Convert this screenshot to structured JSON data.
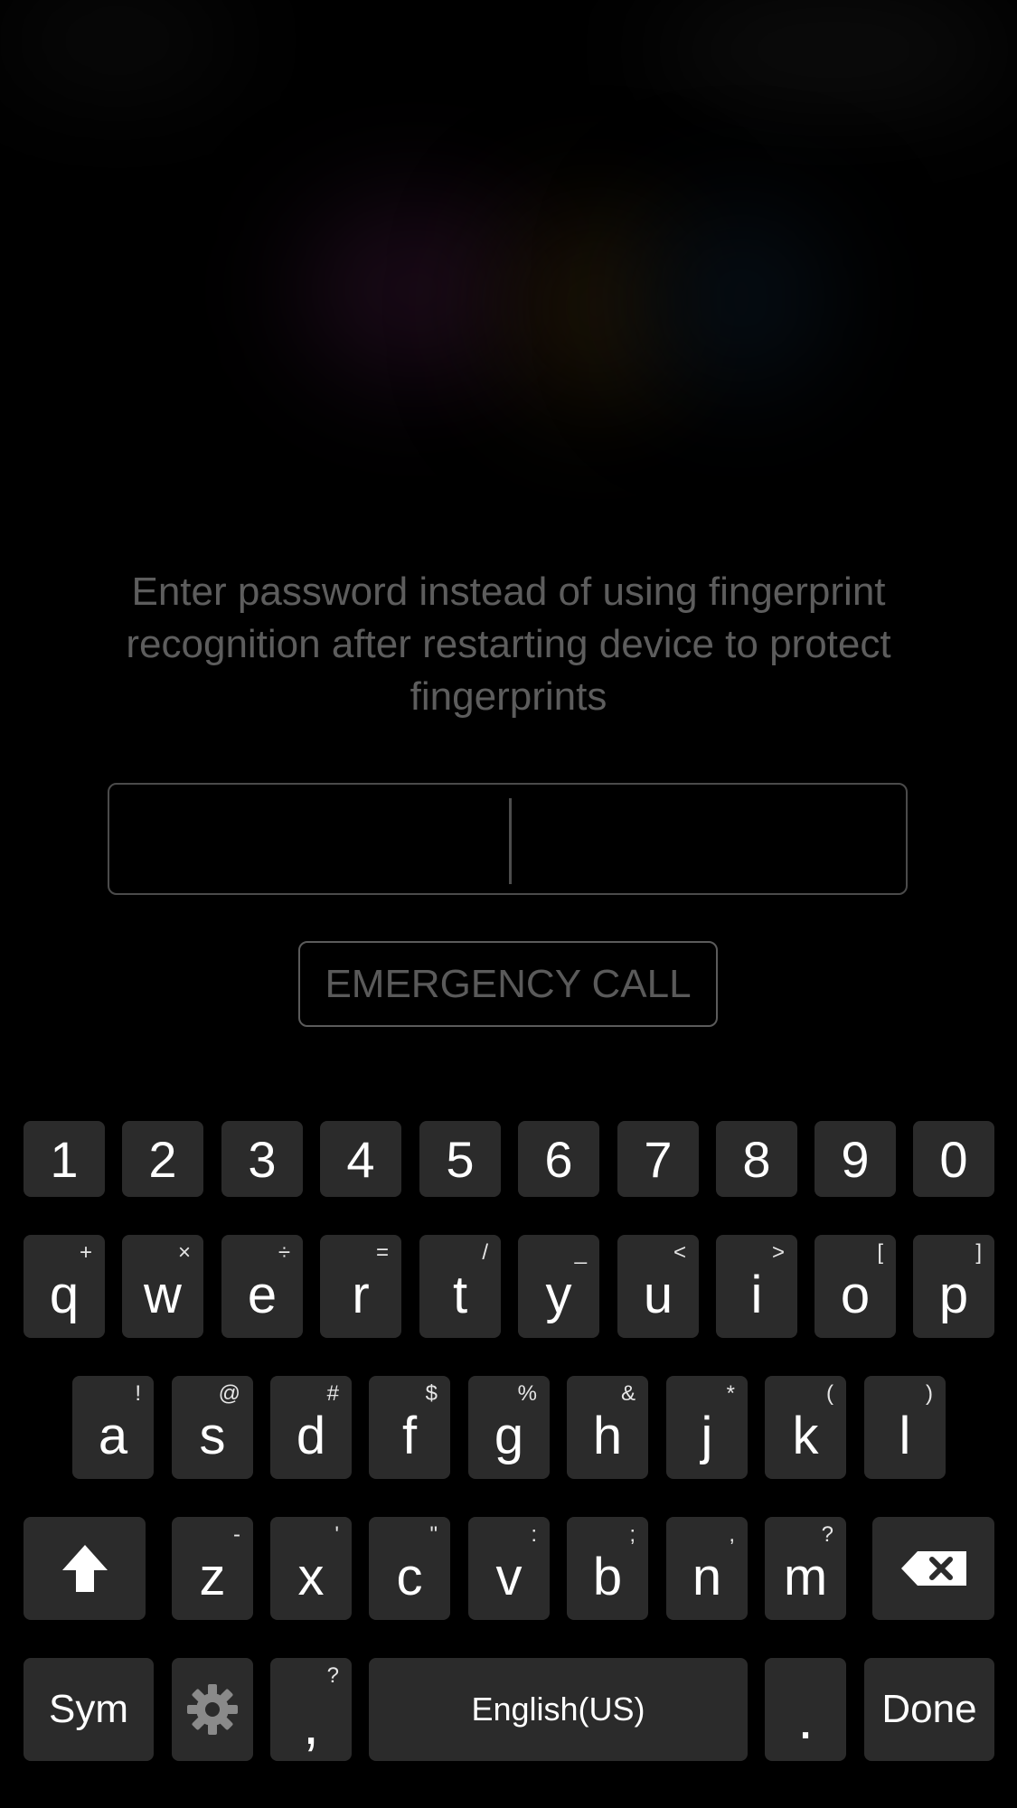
{
  "lockscreen": {
    "message": "Enter password instead of using fingerprint recognition after restarting device to protect fingerprints",
    "password_value": "",
    "emergency_label": "EMERGENCY CALL"
  },
  "keyboard": {
    "numbers": [
      "1",
      "2",
      "3",
      "4",
      "5",
      "6",
      "7",
      "8",
      "9",
      "0"
    ],
    "row1": [
      {
        "key": "q",
        "hint": "+"
      },
      {
        "key": "w",
        "hint": "×"
      },
      {
        "key": "e",
        "hint": "÷"
      },
      {
        "key": "r",
        "hint": "="
      },
      {
        "key": "t",
        "hint": "/"
      },
      {
        "key": "y",
        "hint": "_"
      },
      {
        "key": "u",
        "hint": "<"
      },
      {
        "key": "i",
        "hint": ">"
      },
      {
        "key": "o",
        "hint": "["
      },
      {
        "key": "p",
        "hint": "]"
      }
    ],
    "row2": [
      {
        "key": "a",
        "hint": "!"
      },
      {
        "key": "s",
        "hint": "@"
      },
      {
        "key": "d",
        "hint": "#"
      },
      {
        "key": "f",
        "hint": "$"
      },
      {
        "key": "g",
        "hint": "%"
      },
      {
        "key": "h",
        "hint": "&"
      },
      {
        "key": "j",
        "hint": "*"
      },
      {
        "key": "k",
        "hint": "("
      },
      {
        "key": "l",
        "hint": ")"
      }
    ],
    "row3": [
      {
        "key": "z",
        "hint": "-"
      },
      {
        "key": "x",
        "hint": "'"
      },
      {
        "key": "c",
        "hint": "\""
      },
      {
        "key": "v",
        "hint": ":"
      },
      {
        "key": "b",
        "hint": ";"
      },
      {
        "key": "n",
        "hint": ","
      },
      {
        "key": "m",
        "hint": "?"
      }
    ],
    "bottom": {
      "sym_label": "Sym",
      "settings_icon": "gear-icon",
      "comma_label": ",",
      "comma_hint": "?",
      "space_label": "English(US)",
      "period_label": ".",
      "done_label": "Done"
    },
    "shift_icon": "shift-arrow-icon",
    "backspace_icon": "backspace-icon"
  }
}
